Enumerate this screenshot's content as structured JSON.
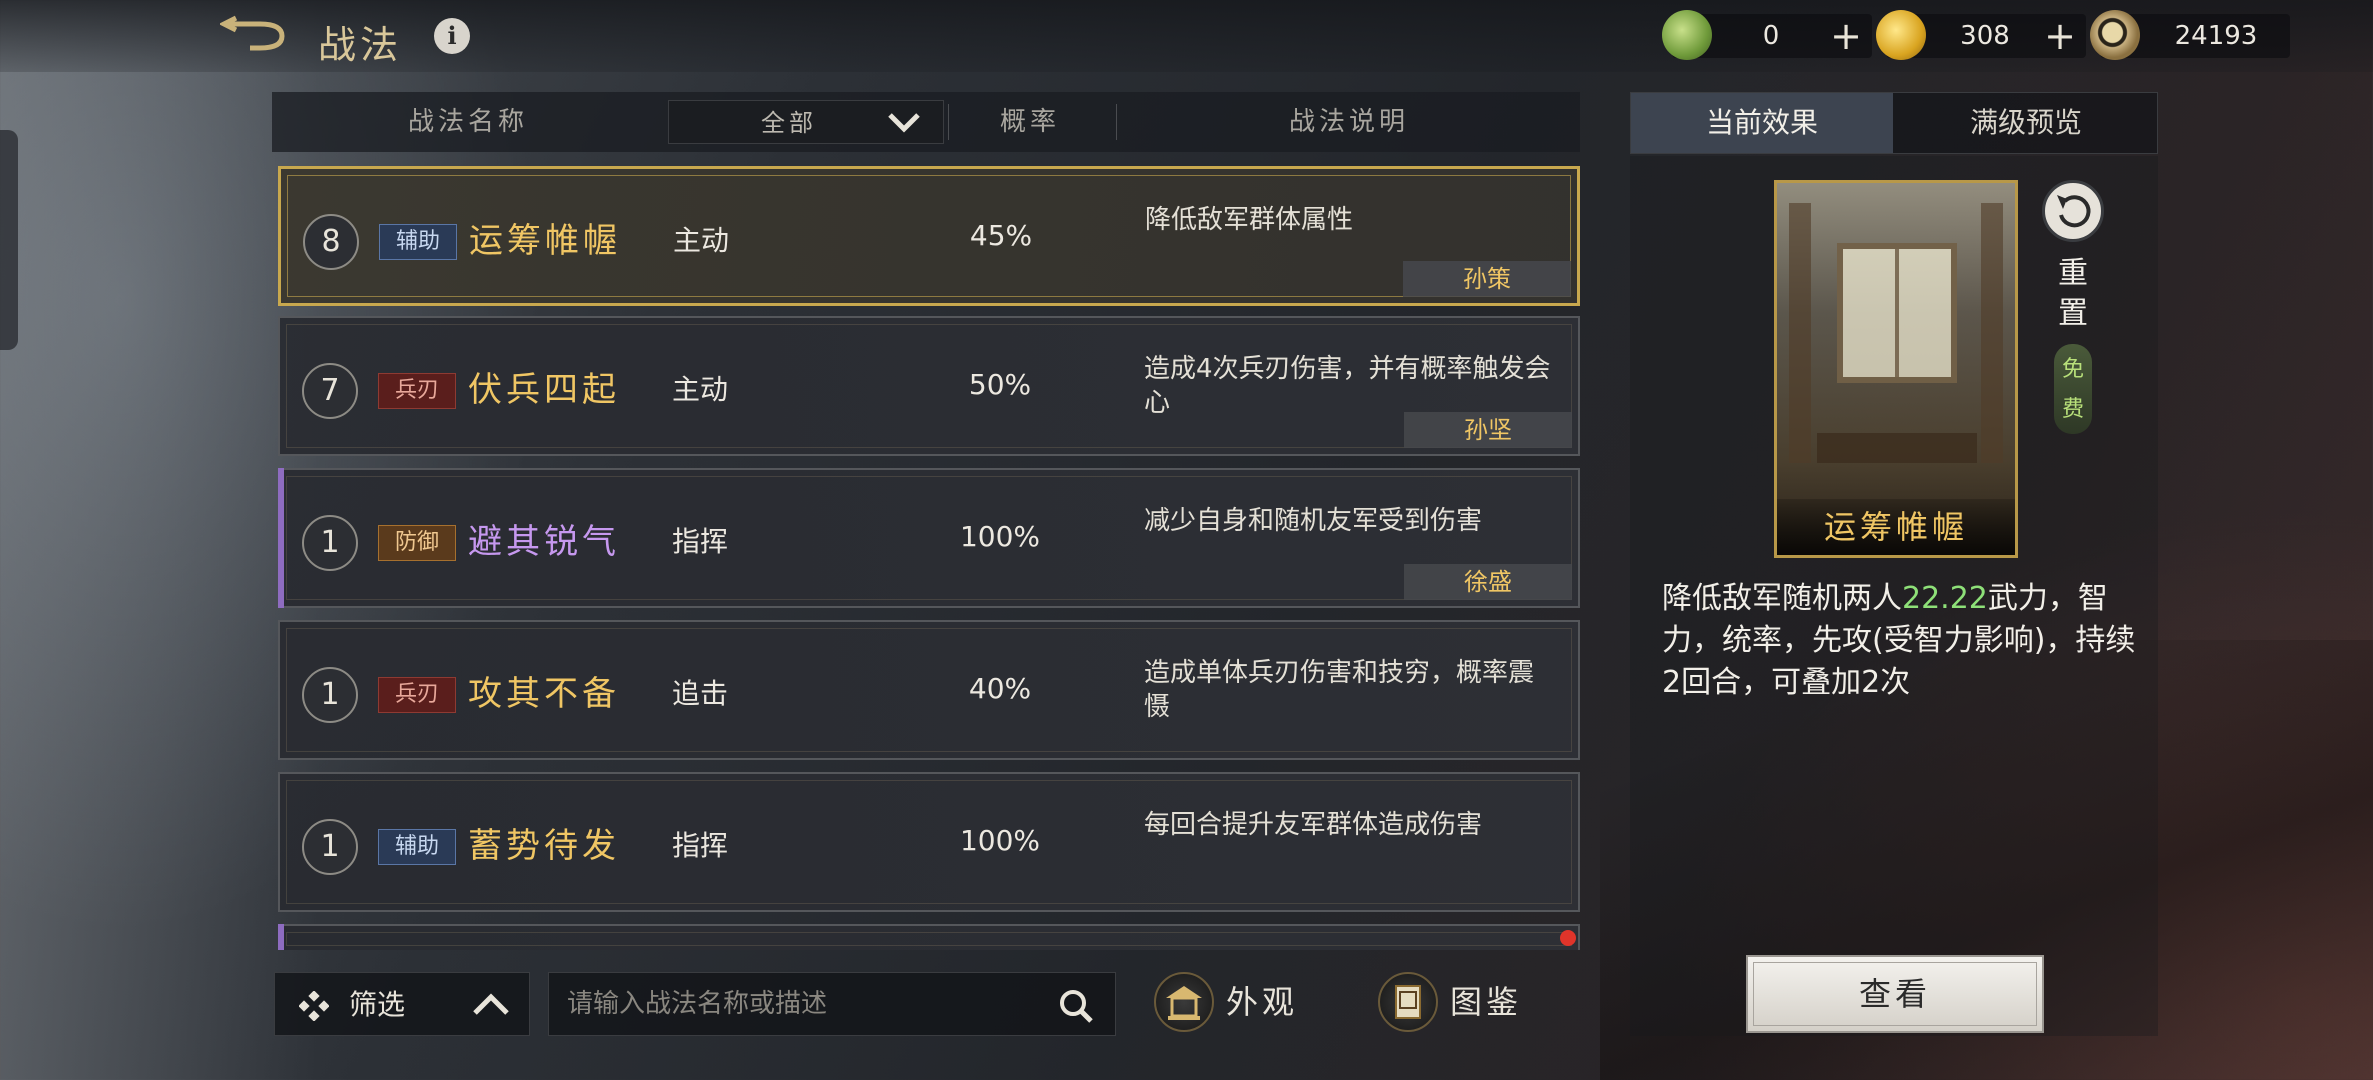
{
  "header": {
    "title": "战法",
    "info_icon": "info-icon",
    "back_icon": "back-arrow-icon"
  },
  "resources": [
    {
      "icon": "jade-coin-icon",
      "value": "0",
      "plus": "+"
    },
    {
      "icon": "gold-coin-icon",
      "value": "308",
      "plus": "+"
    },
    {
      "icon": "copper-coin-icon",
      "value": "24193"
    }
  ],
  "table_header": {
    "name": "战法名称",
    "filter_selected": "全部",
    "rate": "概率",
    "description": "战法说明"
  },
  "rows": [
    {
      "level": "8",
      "tag": "辅助",
      "name": "运筹帷幄",
      "type": "主动",
      "rate": "45%",
      "description": "降低敌军群体属性",
      "hero": "孙策"
    },
    {
      "level": "7",
      "tag": "兵刃",
      "name": "伏兵四起",
      "type": "主动",
      "rate": "50%",
      "description": "造成4次兵刃伤害，并有概率触发会心",
      "hero": "孙坚"
    },
    {
      "level": "1",
      "tag": "防御",
      "name": "避其锐气",
      "type": "指挥",
      "rate": "100%",
      "description": "减少自身和随机友军受到伤害",
      "hero": "徐盛"
    },
    {
      "level": "1",
      "tag": "兵刃",
      "name": "攻其不备",
      "type": "追击",
      "rate": "40%",
      "description": "造成单体兵刃伤害和技穷，概率震慑"
    },
    {
      "level": "1",
      "tag": "辅助",
      "name": "蓄势待发",
      "type": "指挥",
      "rate": "100%",
      "description": "每回合提升友军群体造成伤害"
    }
  ],
  "bottom": {
    "filter_label": "筛选",
    "search_placeholder": "请输入战法名称或描述",
    "appearance_label": "外观",
    "codex_label": "图鉴"
  },
  "right_panel": {
    "tabs": [
      "当前效果",
      "满级预览"
    ],
    "card_name": "运筹帷幄",
    "reset_label": "重置",
    "free_label": "免费",
    "effect_pre": "降低敌军随机两人",
    "effect_value": "22.22",
    "effect_post": "武力，智力，统率，先攻(受智力影响)，持续2回合，可叠加2次",
    "view_button": "查看"
  },
  "colors": {
    "accent_gold": "#f0c664",
    "highlight_green": "#8ee078",
    "selected_border": "#c8a84e",
    "purple_name": "#c698ef"
  }
}
